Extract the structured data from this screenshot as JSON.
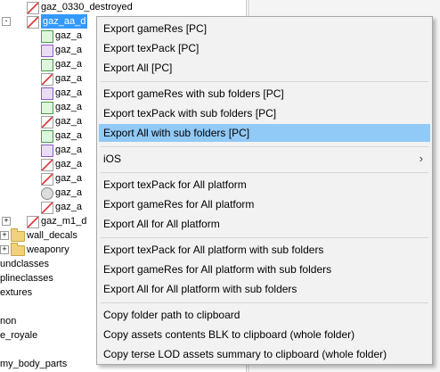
{
  "tree": {
    "rows": [
      {
        "label": "gaz_0330_destroyed",
        "icon": "asset-red",
        "indent": 14
      },
      {
        "label": "gaz_aa_d",
        "icon": "asset-red",
        "indent": 14,
        "selected": true,
        "expander": "-"
      },
      {
        "label": "gaz_a",
        "icon": "asset-green",
        "indent": 30
      },
      {
        "label": "gaz_a",
        "icon": "asset-purple",
        "indent": 30
      },
      {
        "label": "gaz_a",
        "icon": "asset-green",
        "indent": 30
      },
      {
        "label": "gaz_a",
        "icon": "asset-red",
        "indent": 30
      },
      {
        "label": "gaz_a",
        "icon": "asset-purple",
        "indent": 30
      },
      {
        "label": "gaz_a",
        "icon": "asset-green",
        "indent": 30
      },
      {
        "label": "gaz_a",
        "icon": "asset-red",
        "indent": 30
      },
      {
        "label": "gaz_a",
        "icon": "asset-green",
        "indent": 30
      },
      {
        "label": "gaz_a",
        "icon": "asset-purple",
        "indent": 30
      },
      {
        "label": "gaz_a",
        "icon": "asset-red",
        "indent": 30
      },
      {
        "label": "gaz_a",
        "icon": "asset-red",
        "indent": 30
      },
      {
        "label": "gaz_a",
        "icon": "asset-gear",
        "indent": 30
      },
      {
        "label": "gaz_a",
        "icon": "asset-red",
        "indent": 30
      },
      {
        "label": "gaz_m1_d",
        "icon": "asset-red",
        "indent": 14,
        "expander": "+"
      },
      {
        "label": "wall_decals",
        "icon": "folder",
        "indent": 0,
        "expander": "+"
      },
      {
        "label": "weaponry",
        "icon": "folder",
        "indent": 0,
        "expander": "+"
      },
      {
        "label": "undclasses",
        "icon": "none",
        "indent": 0
      },
      {
        "label": "plineclasses",
        "icon": "none",
        "indent": 0
      },
      {
        "label": "extures",
        "icon": "none",
        "indent": 0
      },
      {
        "label": "",
        "icon": "none",
        "indent": 0
      },
      {
        "label": "non",
        "icon": "none",
        "indent": 0
      },
      {
        "label": "e_royale",
        "icon": "none",
        "indent": 0
      },
      {
        "label": "",
        "icon": "none",
        "indent": 0
      },
      {
        "label": "my_body_parts",
        "icon": "none",
        "indent": 0
      }
    ]
  },
  "menu": {
    "groups": [
      [
        "Export gameRes [PC]",
        "Export texPack [PC]",
        "Export All [PC]"
      ],
      [
        "Export gameRes with sub folders [PC]",
        "Export texPack with sub folders [PC]",
        "Export All with sub folders [PC]"
      ],
      [
        "iOS"
      ],
      [
        "Export texPack for All platform",
        "Export gameRes for All platform",
        "Export All for All platform"
      ],
      [
        "Export texPack for All platform with sub folders",
        "Export gameRes for All platform with sub folders",
        "Export All for All platform with sub folders"
      ],
      [
        "Copy folder path to clipboard",
        "Copy assets contents BLK to clipboard (whole folder)",
        "Copy terse LOD assets summary to clipboard (whole folder)"
      ]
    ],
    "highlighted": "Export All with sub folders [PC]",
    "submenu_arrow": "›"
  },
  "colors": {
    "menu_bg": "#f2f2f2",
    "highlight": "#91c9f7",
    "selection": "#3399ff"
  }
}
